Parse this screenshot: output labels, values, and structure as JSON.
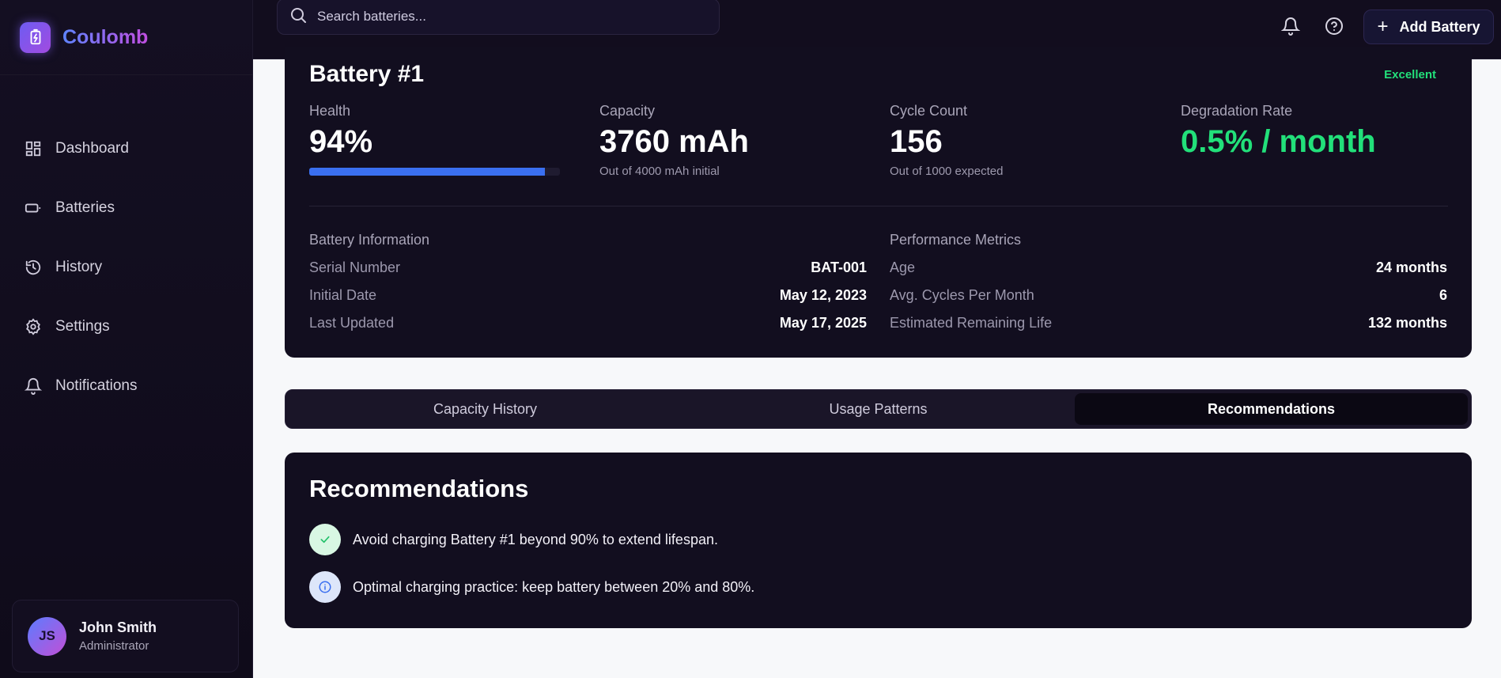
{
  "app": {
    "name": "Coulomb"
  },
  "sidebar": {
    "items": [
      {
        "label": "Dashboard",
        "icon": "dashboard-icon"
      },
      {
        "label": "Batteries",
        "icon": "battery-icon"
      },
      {
        "label": "History",
        "icon": "history-icon"
      },
      {
        "label": "Settings",
        "icon": "gear-icon"
      },
      {
        "label": "Notifications",
        "icon": "bell-icon"
      }
    ],
    "user": {
      "initials": "JS",
      "name": "John Smith",
      "role": "Administrator"
    }
  },
  "topbar": {
    "search_placeholder": "Search batteries...",
    "add_button_label": "Add Battery"
  },
  "battery": {
    "title": "Battery #1",
    "status": "Excellent",
    "metrics": {
      "health": {
        "label": "Health",
        "value": "94%",
        "percent": 94
      },
      "capacity": {
        "label": "Capacity",
        "value": "3760 mAh",
        "sub": "Out of 4000 mAh initial"
      },
      "cycles": {
        "label": "Cycle Count",
        "value": "156",
        "sub": "Out of 1000 expected"
      },
      "degradation": {
        "label": "Degradation Rate",
        "value": "0.5% / month"
      }
    },
    "info": {
      "heading": "Battery Information",
      "rows": [
        {
          "key": "Serial Number",
          "value": "BAT-001"
        },
        {
          "key": "Initial Date",
          "value": "May 12, 2023"
        },
        {
          "key": "Last Updated",
          "value": "May 17, 2025"
        }
      ]
    },
    "performance": {
      "heading": "Performance Metrics",
      "rows": [
        {
          "key": "Age",
          "value": "24 months"
        },
        {
          "key": "Avg. Cycles Per Month",
          "value": "6"
        },
        {
          "key": "Estimated Remaining Life",
          "value": "132 months"
        }
      ]
    }
  },
  "tabs": {
    "items": [
      {
        "label": "Capacity History"
      },
      {
        "label": "Usage Patterns"
      },
      {
        "label": "Recommendations"
      }
    ],
    "active": "Recommendations"
  },
  "recommendations": {
    "title": "Recommendations",
    "items": [
      {
        "text": "Avoid charging Battery #1 beyond 90% to extend lifespan.",
        "icon": "check-icon"
      },
      {
        "text": "Optimal charging practice: keep battery between 20% and 80%.",
        "icon": "info-icon"
      }
    ]
  },
  "colors": {
    "accent_green": "#22e07a",
    "health_bar": "#3a6ff0",
    "brand_gradient_start": "#5f84ff",
    "brand_gradient_end": "#c04ee0"
  }
}
